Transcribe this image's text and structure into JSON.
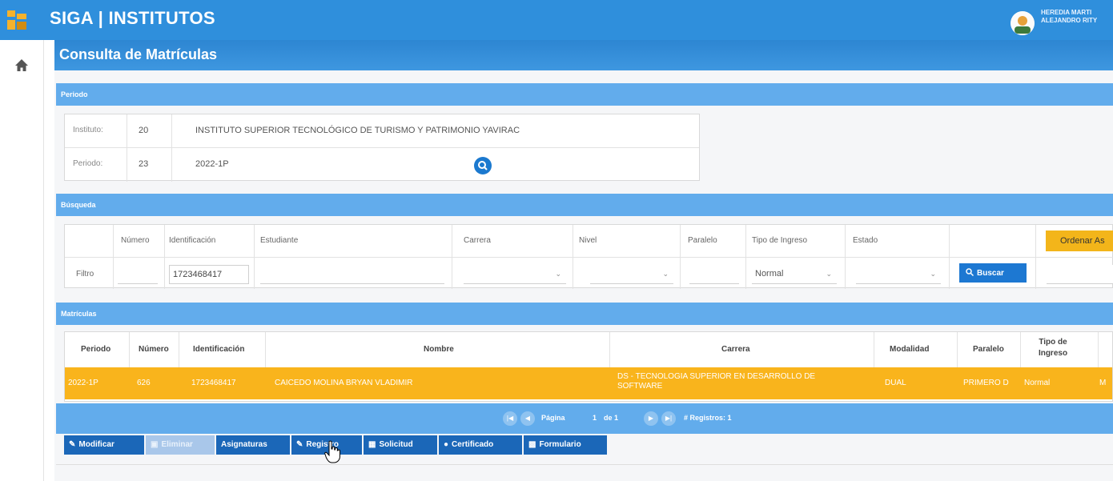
{
  "app": {
    "title": "SIGA | INSTITUTOS",
    "user_name": "HEREDIA MARTI ALEJANDRO RITY"
  },
  "page": {
    "title": "Consulta de Matrículas"
  },
  "periodo_section": {
    "title": "Periodo",
    "rows": [
      {
        "label": "Instituto:",
        "code": "20",
        "value": "INSTITUTO SUPERIOR TECNOLÓGICO DE TURISMO Y PATRIMONIO YAVIRAC"
      },
      {
        "label": "Periodo:",
        "code": "23",
        "value": "2022-1P"
      }
    ]
  },
  "busqueda_section": {
    "title": "Búsqueda",
    "headers": [
      "Número",
      "Identificación",
      "Estudiante",
      "Carrera",
      "Nivel",
      "Paralelo",
      "Tipo de Ingreso",
      "Estado"
    ],
    "filter_label": "Filtro",
    "identificacion_value": "1723468417",
    "tipo_ingreso_value": "Normal",
    "buscar_label": "Buscar",
    "ordenar_label": "Ordenar As"
  },
  "matriculas_section": {
    "title": "Matrículas",
    "headers": [
      "Periodo",
      "Número",
      "Identificación",
      "Nombre",
      "Carrera",
      "Modalidad",
      "Paralelo",
      "Tipo de Ingreso"
    ],
    "rows": [
      {
        "periodo": "2022-1P",
        "numero": "626",
        "identificacion": "1723468417",
        "nombre": "CAICEDO MOLINA BRYAN VLADIMIR",
        "carrera": "DS - TECNOLOGIA SUPERIOR EN DESARROLLO DE SOFTWARE",
        "modalidad": "DUAL",
        "paralelo": "PRIMERO D",
        "tipo_ingreso": "Normal",
        "extra": "M"
      }
    ],
    "pager": {
      "page_label": "Página",
      "page_value": "1",
      "of_label": "de 1",
      "records_label": "# Registros: 1"
    }
  },
  "actions": [
    {
      "label": "Modificar",
      "icon": "pencil-icon"
    },
    {
      "label": "Eliminar",
      "icon": "trash-icon",
      "disabled": true
    },
    {
      "label": "Asignaturas",
      "icon": ""
    },
    {
      "label": "Registro",
      "icon": "edit-icon"
    },
    {
      "label": "Solicitud",
      "icon": "card-icon"
    },
    {
      "label": "Certificado",
      "icon": "circle-icon"
    },
    {
      "label": "Formulario",
      "icon": "document-icon"
    }
  ],
  "colors": {
    "primary": "#2f8fdc",
    "section": "#62acec",
    "selected_row": "#f9b41c",
    "button": "#1b67b8",
    "accent": "#f3b51a"
  }
}
